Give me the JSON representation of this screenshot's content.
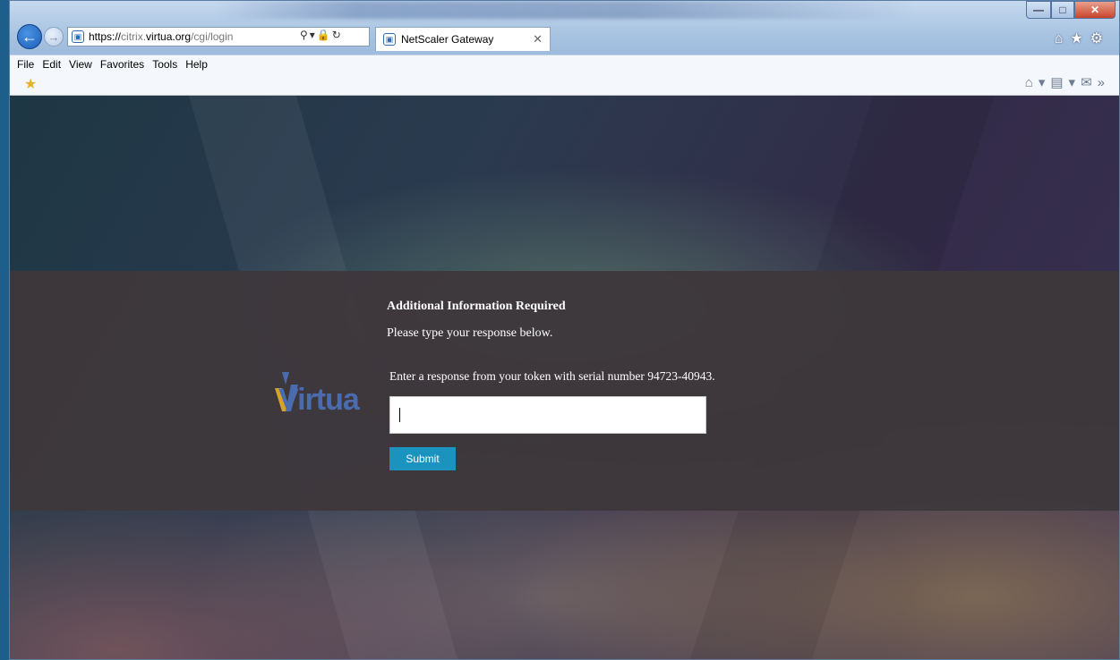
{
  "browser": {
    "url_scheme": "https://",
    "url_host_pre": "citrix.",
    "url_host_main": "virtua.org",
    "url_path": "/cgi/login",
    "tab_title": "NetScaler Gateway",
    "menu": [
      "File",
      "Edit",
      "View",
      "Favorites",
      "Tools",
      "Help"
    ],
    "icons": {
      "back": "back-arrow-icon",
      "forward": "forward-arrow-icon",
      "lock": "lock-icon",
      "home": "home-icon",
      "favorites": "star-icon",
      "settings": "gear-icon"
    }
  },
  "page": {
    "logo_text": "Virtua",
    "heading": "Additional Information Required",
    "subheading": "Please type your response below.",
    "prompt": "Enter a response from your token with serial number 94723-40943.",
    "response_value": "",
    "submit_label": "Submit"
  },
  "colors": {
    "submit_bg": "#1b93bf",
    "panel_bg": "#3e383c",
    "logo_blue": "#4a6cae",
    "logo_gold": "#d6a32a"
  }
}
